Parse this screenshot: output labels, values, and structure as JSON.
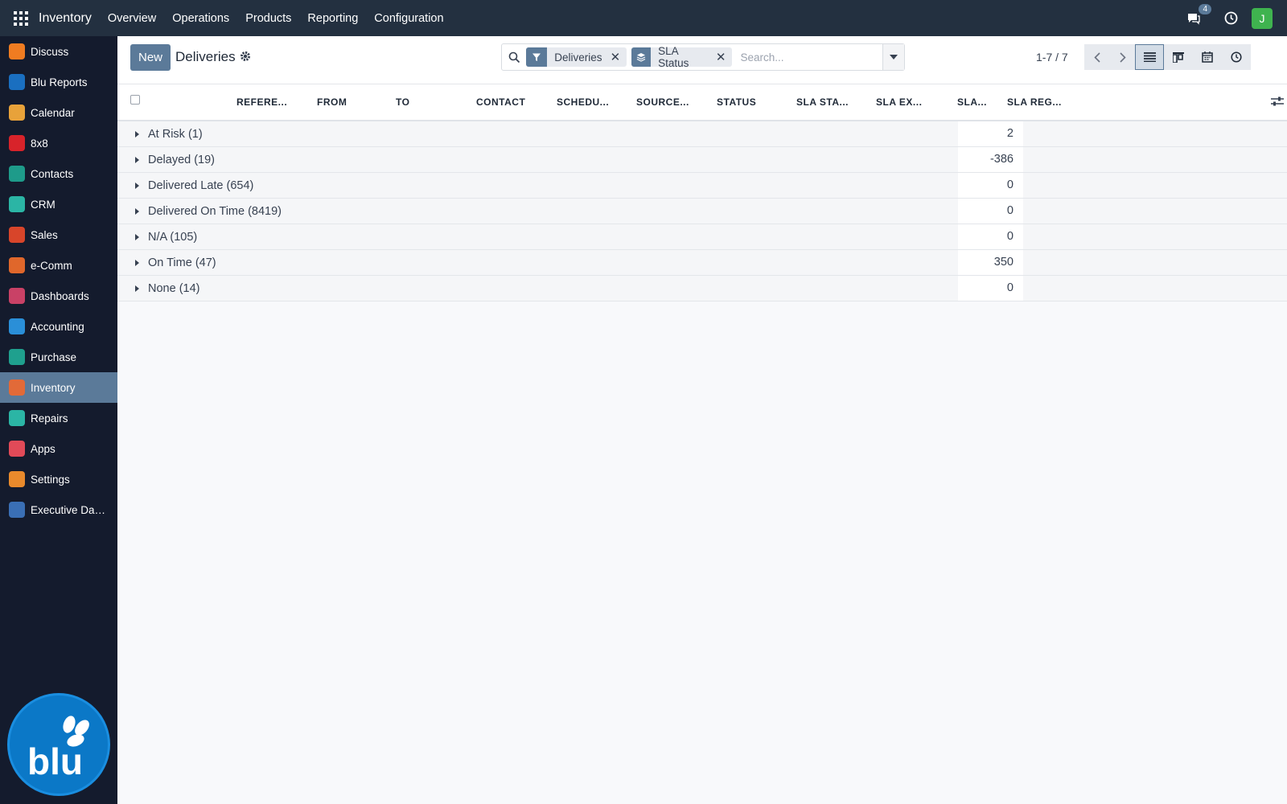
{
  "navbar": {
    "app_title": "Inventory",
    "menu": [
      "Overview",
      "Operations",
      "Products",
      "Reporting",
      "Configuration"
    ],
    "chat_count": "4",
    "avatar_initial": "J"
  },
  "sidebar": {
    "items": [
      {
        "label": "Discuss",
        "icon": "discuss-icon",
        "color": "#f07c21"
      },
      {
        "label": "Blu Reports",
        "icon": "blu-reports-icon",
        "color": "#1a6fc0"
      },
      {
        "label": "Calendar",
        "icon": "calendar-icon",
        "color": "#e8a23a"
      },
      {
        "label": "8x8",
        "icon": "8x8-icon",
        "color": "#d8232a"
      },
      {
        "label": "Contacts",
        "icon": "contacts-icon",
        "color": "#1e9b8a"
      },
      {
        "label": "CRM",
        "icon": "crm-icon",
        "color": "#2bb5a5"
      },
      {
        "label": "Sales",
        "icon": "sales-icon",
        "color": "#d8452a"
      },
      {
        "label": "e-Comm",
        "icon": "ecommerce-icon",
        "color": "#e0672b"
      },
      {
        "label": "Dashboards",
        "icon": "dashboards-icon",
        "color": "#c94166"
      },
      {
        "label": "Accounting",
        "icon": "accounting-icon",
        "color": "#2a8fd8"
      },
      {
        "label": "Purchase",
        "icon": "purchase-icon",
        "color": "#1fa08e"
      },
      {
        "label": "Inventory",
        "icon": "inventory-icon",
        "color": "#e26a38",
        "active": true
      },
      {
        "label": "Repairs",
        "icon": "repairs-icon",
        "color": "#2bb5a5"
      },
      {
        "label": "Apps",
        "icon": "apps-store-icon",
        "color": "#e14a58"
      },
      {
        "label": "Settings",
        "icon": "settings-icon",
        "color": "#e98a2c"
      },
      {
        "label": "Executive Das...",
        "icon": "executive-dashboard-icon",
        "color": "#3a6fb5"
      }
    ],
    "logo_text": "blu"
  },
  "control": {
    "new_label": "New",
    "breadcrumb": "Deliveries",
    "facets": [
      {
        "label": "Deliveries",
        "icon": "filter-icon"
      },
      {
        "label": "SLA Status",
        "icon": "group-by-icon"
      }
    ],
    "search_placeholder": "Search...",
    "pager": "1-7 / 7"
  },
  "list": {
    "columns": [
      "REFERE...",
      "FROM",
      "TO",
      "CONTACT",
      "SCHEDU...",
      "SOURCE...",
      "STATUS",
      "SLA STA...",
      "SLA EX...",
      "SLA...",
      "SLA REG..."
    ],
    "groups": [
      {
        "label": "At Risk (1)",
        "value": "2"
      },
      {
        "label": "Delayed (19)",
        "value": "-386"
      },
      {
        "label": "Delivered Late (654)",
        "value": "0"
      },
      {
        "label": "Delivered On Time (8419)",
        "value": "0"
      },
      {
        "label": "N/A (105)",
        "value": "0"
      },
      {
        "label": "On Time (47)",
        "value": "350"
      },
      {
        "label": "None (14)",
        "value": "0"
      }
    ]
  },
  "colors": {
    "navbar": "#233040",
    "sidebar": "#141b2d",
    "accent": "#5b7a99"
  }
}
